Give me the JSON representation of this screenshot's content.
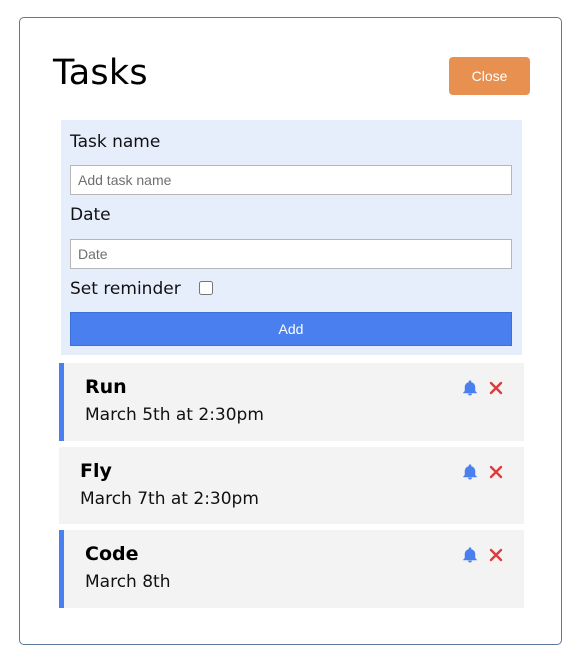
{
  "header": {
    "title": "Tasks",
    "close_label": "Close"
  },
  "form": {
    "task_label": "Task name",
    "task_placeholder": "Add task name",
    "date_label": "Date",
    "date_placeholder": "Date",
    "reminder_label": "Set reminder",
    "reminder_checked": false,
    "add_label": "Add"
  },
  "tasks": [
    {
      "name": "Run",
      "date": "March 5th at 2:30pm",
      "reminder": true
    },
    {
      "name": "Fly",
      "date": "March 7th at 2:30pm",
      "reminder": false
    },
    {
      "name": "Code",
      "date": "March 8th",
      "reminder": true
    }
  ],
  "colors": {
    "close": "#e8904f",
    "add": "#4a7fef",
    "reminder_border": "#4a7fef",
    "form_bg": "#e6eefc",
    "bell": "#4a7fef",
    "delete": "#e03a3a"
  },
  "icons": {
    "reminder": "bell-icon",
    "delete": "close-icon"
  }
}
